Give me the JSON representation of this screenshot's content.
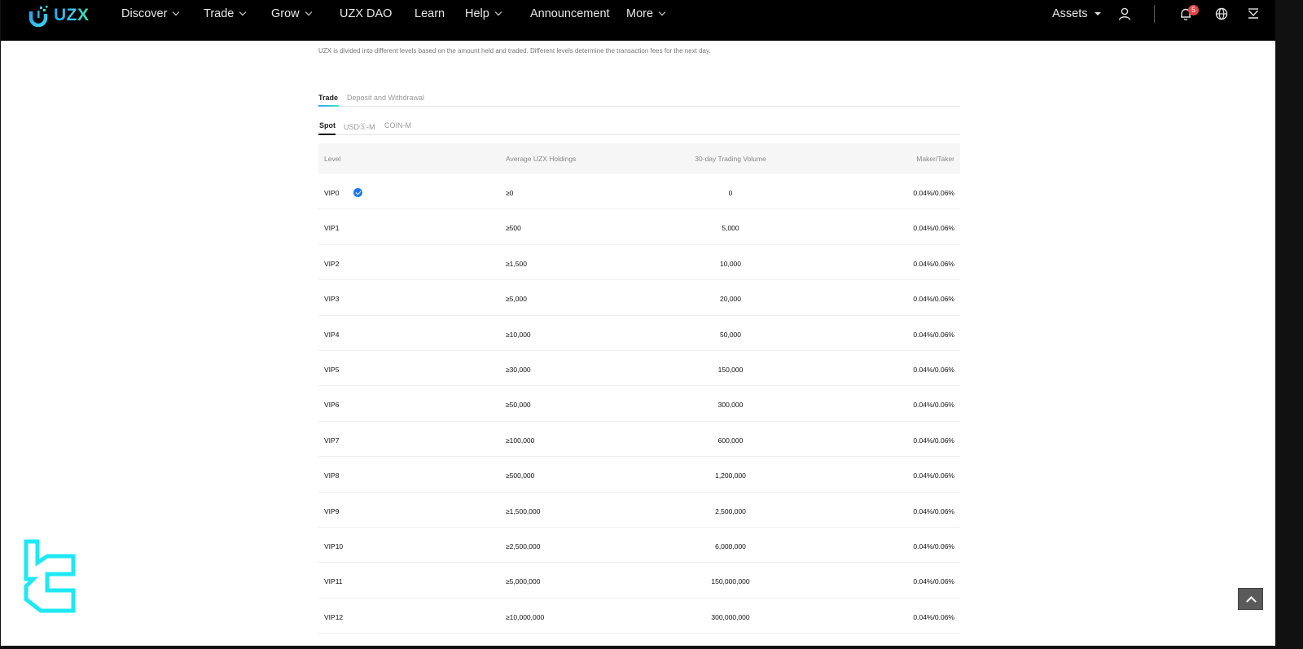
{
  "brand": {
    "name": "UZX",
    "accent": "#2aa8f0",
    "accent2": "#3de3a4"
  },
  "nav": {
    "items": [
      {
        "label": "Discover",
        "dropdown": true
      },
      {
        "label": "Trade",
        "dropdown": true
      },
      {
        "label": "Grow",
        "dropdown": true
      },
      {
        "label": "UZX DAO",
        "dropdown": false
      },
      {
        "label": "Learn",
        "dropdown": false
      },
      {
        "label": "Help",
        "dropdown": true
      },
      {
        "label": "Announcement",
        "dropdown": false
      },
      {
        "label": "More",
        "dropdown": true
      }
    ],
    "assets_label": "Assets",
    "notification_count": "5",
    "icons": [
      "user-icon",
      "bell-icon",
      "globe-icon",
      "download-icon"
    ]
  },
  "intro_text": "UZX is divided into different levels based on the amount held and traded. Different levels determine the transaction fees for the next day.",
  "tabs": [
    {
      "label": "Trade",
      "active": true
    },
    {
      "label": "Deposit and Withdrawal",
      "active": false
    }
  ],
  "subtabs": [
    {
      "label": "Spot",
      "active": true
    },
    {
      "label": "USDⓈ-M",
      "active": false
    },
    {
      "label": "COIN-M",
      "active": false
    }
  ],
  "table": {
    "headers": [
      "Level",
      "Average UZX Holdings",
      "30-day Trading Volume",
      "Maker/Taker"
    ],
    "current_level": "VIP0",
    "rows": [
      {
        "level": "VIP0",
        "holdings": "≥0",
        "volume": "0",
        "fee": "0.04%/0.06%"
      },
      {
        "level": "VIP1",
        "holdings": "≥500",
        "volume": "5,000",
        "fee": "0.04%/0.06%"
      },
      {
        "level": "VIP2",
        "holdings": "≥1,500",
        "volume": "10,000",
        "fee": "0.04%/0.06%"
      },
      {
        "level": "VIP3",
        "holdings": "≥5,000",
        "volume": "20,000",
        "fee": "0.04%/0.06%"
      },
      {
        "level": "VIP4",
        "holdings": "≥10,000",
        "volume": "50,000",
        "fee": "0.04%/0.06%"
      },
      {
        "level": "VIP5",
        "holdings": "≥30,000",
        "volume": "150,000",
        "fee": "0.04%/0.06%"
      },
      {
        "level": "VIP6",
        "holdings": "≥50,000",
        "volume": "300,000",
        "fee": "0.04%/0.06%"
      },
      {
        "level": "VIP7",
        "holdings": "≥100,000",
        "volume": "600,000",
        "fee": "0.04%/0.06%"
      },
      {
        "level": "VIP8",
        "holdings": "≥500,000",
        "volume": "1,200,000",
        "fee": "0.04%/0.06%"
      },
      {
        "level": "VIP9",
        "holdings": "≥1,500,000",
        "volume": "2,500,000",
        "fee": "0.04%/0.06%"
      },
      {
        "level": "VIP10",
        "holdings": "≥2,500,000",
        "volume": "6,000,000",
        "fee": "0.04%/0.06%"
      },
      {
        "level": "VIP11",
        "holdings": "≥5,000,000",
        "volume": "150,000,000",
        "fee": "0.04%/0.06%"
      },
      {
        "level": "VIP12",
        "holdings": "≥10,000,000",
        "volume": "300,000,000",
        "fee": "0.04%/0.06%"
      }
    ]
  }
}
